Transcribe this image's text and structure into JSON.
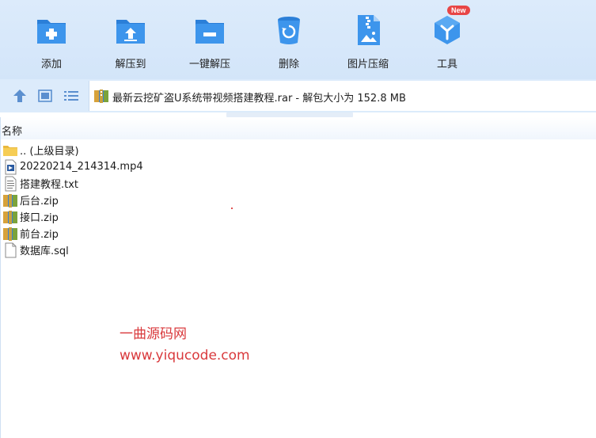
{
  "toolbar": {
    "items": [
      {
        "id": "add",
        "label": "添加",
        "icon": "folder-plus-icon"
      },
      {
        "id": "extract-to",
        "label": "解压到",
        "icon": "folder-extract-icon"
      },
      {
        "id": "one-click-extract",
        "label": "一键解压",
        "icon": "folder-minus-icon"
      },
      {
        "id": "delete",
        "label": "删除",
        "icon": "recycle-bin-icon"
      },
      {
        "id": "image-compress",
        "label": "图片压缩",
        "icon": "zip-image-icon"
      },
      {
        "id": "tools",
        "label": "工具",
        "icon": "tools-cube-icon",
        "badge": "New"
      }
    ],
    "accent": "#3a8ee6"
  },
  "address": {
    "text": "最新云挖矿盗U系统带视频搭建教程.rar - 解包大小为 152.8 MB"
  },
  "list": {
    "column_name": "名称",
    "items": [
      {
        "name": ".. (上级目录)",
        "icon": "folder-icon"
      },
      {
        "name": "20220214_214314.mp4",
        "icon": "video-file-icon"
      },
      {
        "name": "搭建教程.txt",
        "icon": "text-file-icon"
      },
      {
        "name": "后台.zip",
        "icon": "archive-icon"
      },
      {
        "name": "接口.zip",
        "icon": "archive-icon"
      },
      {
        "name": "前台.zip",
        "icon": "archive-icon"
      },
      {
        "name": "数据库.sql",
        "icon": "blank-file-icon"
      }
    ]
  },
  "watermark": {
    "line1": "一曲源码网",
    "line2": "www.yiqucode.com"
  }
}
